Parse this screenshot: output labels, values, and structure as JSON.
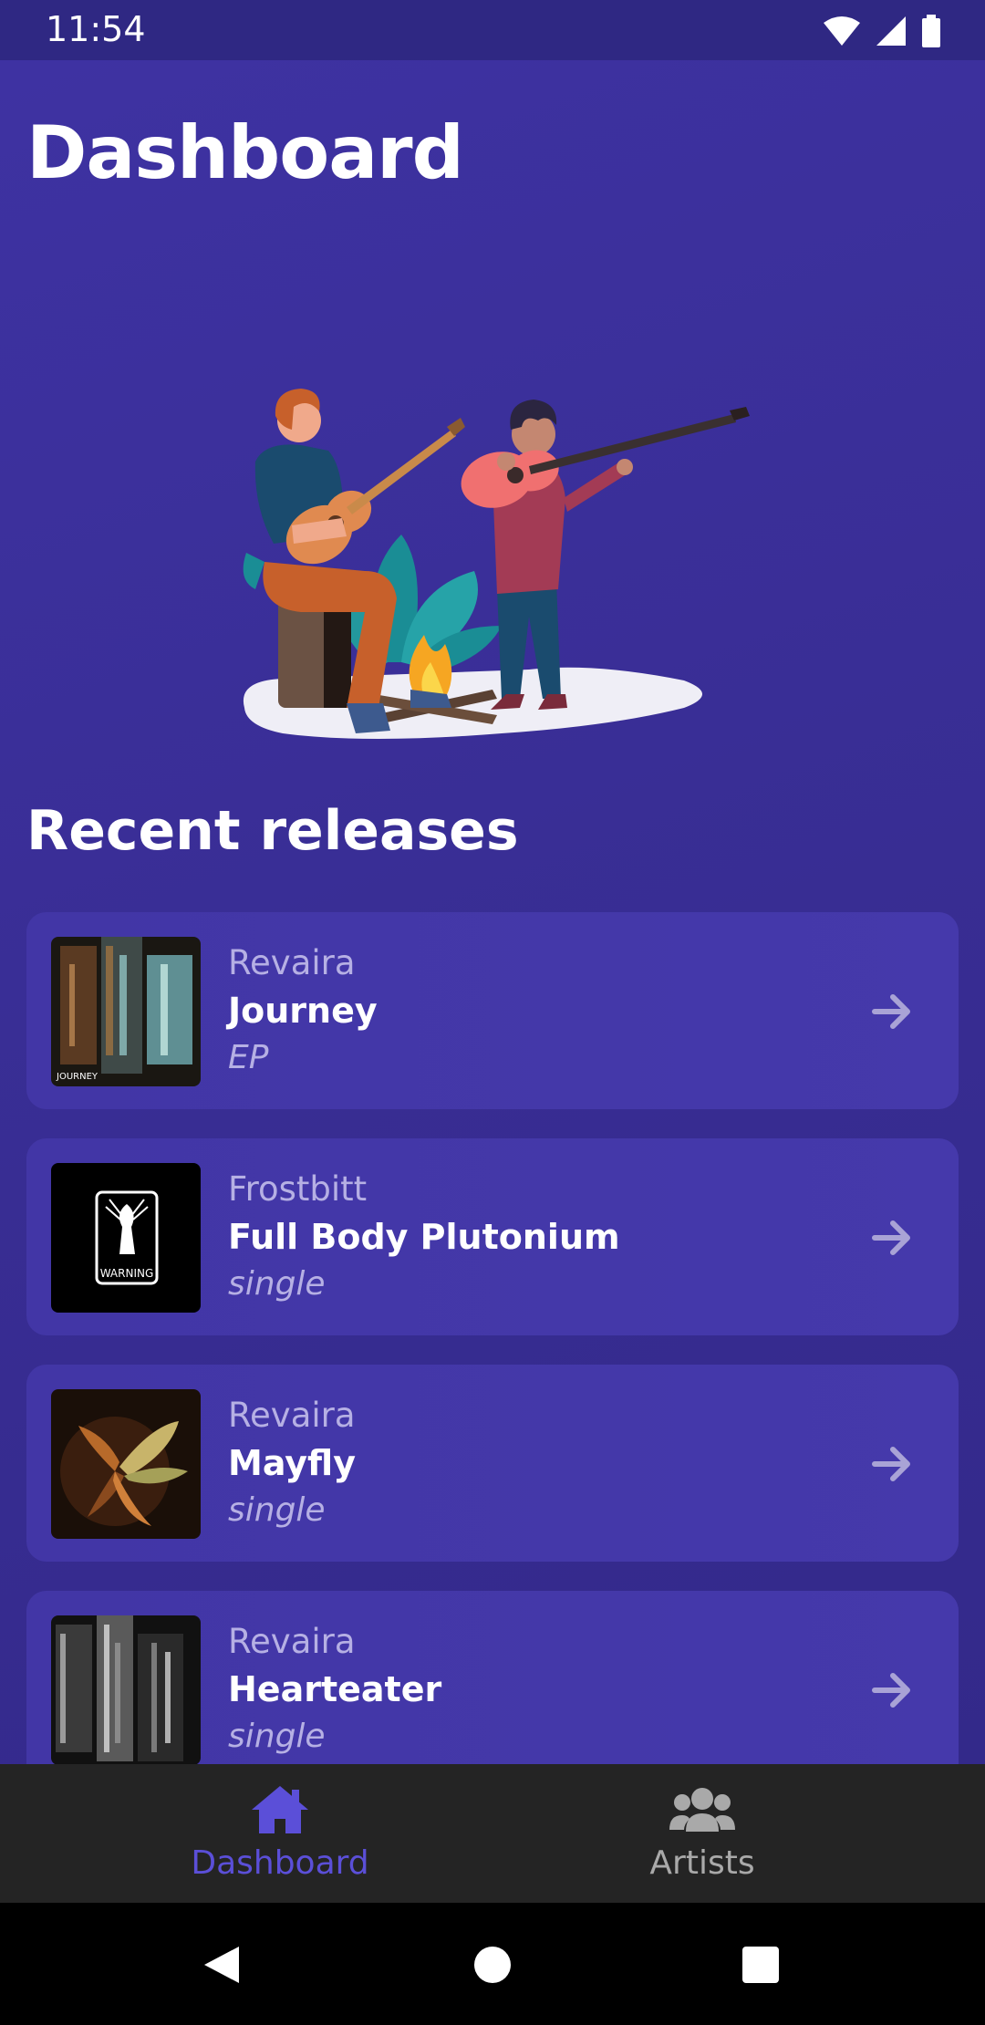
{
  "status": {
    "time": "11:54"
  },
  "page": {
    "title": "Dashboard",
    "section_title": "Recent releases"
  },
  "releases": [
    {
      "artist": "Revaira",
      "title": "Journey",
      "type": "EP"
    },
    {
      "artist": "Frostbitt",
      "title": "Full Body Plutonium",
      "type": "single"
    },
    {
      "artist": "Revaira",
      "title": "Mayfly",
      "type": "single"
    },
    {
      "artist": "Revaira",
      "title": "Hearteater",
      "type": "single"
    }
  ],
  "cover_text": {
    "journey": "JOURNEY",
    "warning": "WARNING"
  },
  "bottom_nav": {
    "items": [
      {
        "label": "Dashboard",
        "icon": "home-icon",
        "active": true
      },
      {
        "label": "Artists",
        "icon": "users-icon",
        "active": false
      }
    ]
  },
  "colors": {
    "background": "#3a2e95",
    "card": "#4337a8",
    "active_nav": "#5b4fd8",
    "inactive_nav": "#a9a9a9"
  }
}
